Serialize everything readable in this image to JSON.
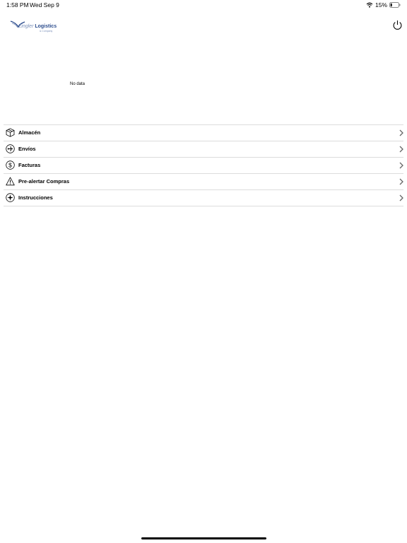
{
  "status_bar": {
    "time": "1:58 PM",
    "date": "Wed Sep 9",
    "battery": "15%",
    "icons": [
      "wifi-icon",
      "battery-icon"
    ]
  },
  "header": {
    "logo_text_light": "Zingler",
    "logo_text_bold": "Logistics",
    "logo_subtext": "& Company",
    "power_icon": "power-icon",
    "brand_color": "#2a4b8c"
  },
  "chart": {
    "empty_text": "No data"
  },
  "menu": {
    "items": [
      {
        "label": "Almacén",
        "icon": "package-icon"
      },
      {
        "label": "Envíos",
        "icon": "airplane-icon"
      },
      {
        "label": "Facturas",
        "icon": "dollar-icon"
      },
      {
        "label": "Pre-alertar Compras",
        "icon": "warning-icon"
      },
      {
        "label": "Instrucciones",
        "icon": "compass-icon"
      }
    ]
  }
}
